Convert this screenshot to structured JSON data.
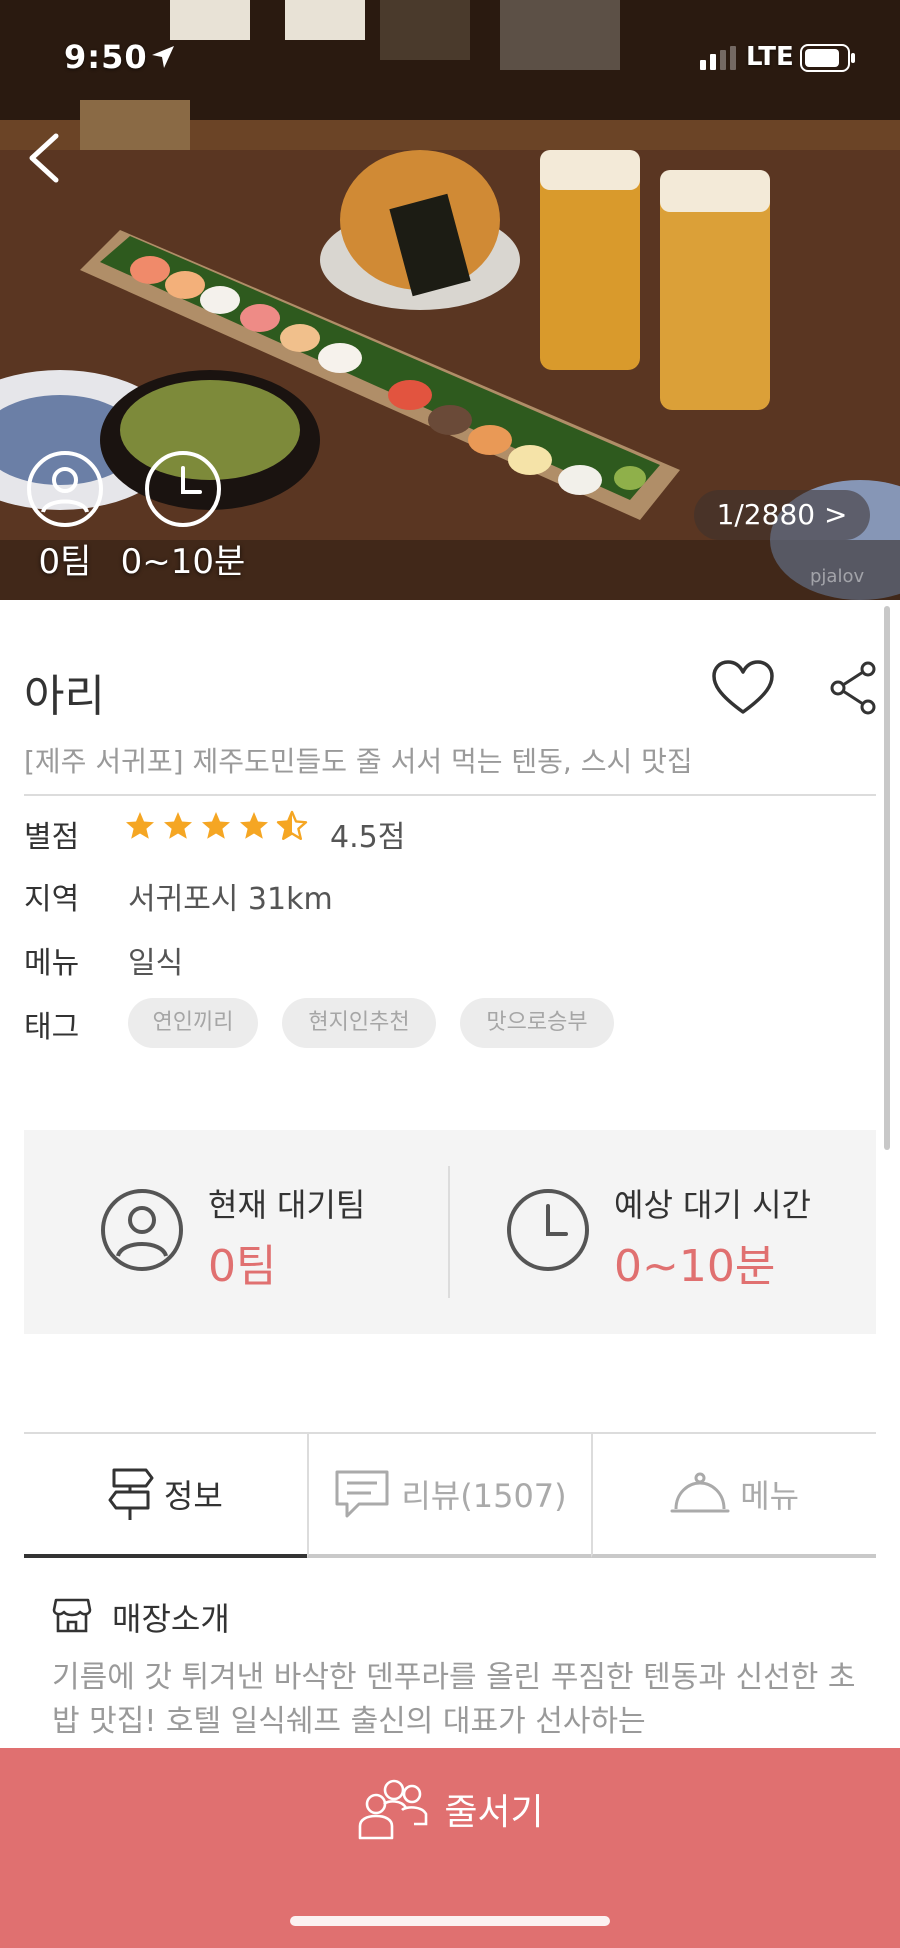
{
  "status_bar": {
    "time": "9:50",
    "network": "LTE"
  },
  "hero": {
    "team_count": "0팀",
    "wait_time": "0~10분",
    "photo_counter": "1/2880 >",
    "watermark": "pjalov"
  },
  "restaurant": {
    "name": "아리",
    "subtitle": "[제주 서귀포] 제주도민들도 줄 서서 먹는 텐동, 스시 맛집",
    "rating_label": "별점",
    "rating_value": 4.5,
    "rating_text": "4.5점",
    "region_label": "지역",
    "region_value": "서귀포시 31km",
    "menu_label": "메뉴",
    "menu_value": "일식",
    "tag_label": "태그",
    "tags": [
      "연인끼리",
      "현지인추천",
      "맛으로승부"
    ]
  },
  "wait": {
    "current_label": "현재 대기팀",
    "current_value": "0팀",
    "estimate_label": "예상 대기 시간",
    "estimate_value": "0~10분"
  },
  "tabs": [
    {
      "label": "정보",
      "icon": "signpost-icon",
      "active": true
    },
    {
      "label": "리뷰(1507)",
      "icon": "comment-icon",
      "active": false
    },
    {
      "label": "메뉴",
      "icon": "cloche-icon",
      "active": false
    }
  ],
  "intro": {
    "title": "매장소개",
    "text": "기름에 갓 튀겨낸 바삭한 덴푸라를 올린 푸짐한 텐동과 신선한 초밥 맛집! 호텔 일식쉐프 출신의 대표가 선사하는"
  },
  "cta": {
    "label": "줄서기"
  },
  "colors": {
    "accent": "#e07070",
    "star": "#f5a623",
    "tag_bg": "#ececec"
  }
}
